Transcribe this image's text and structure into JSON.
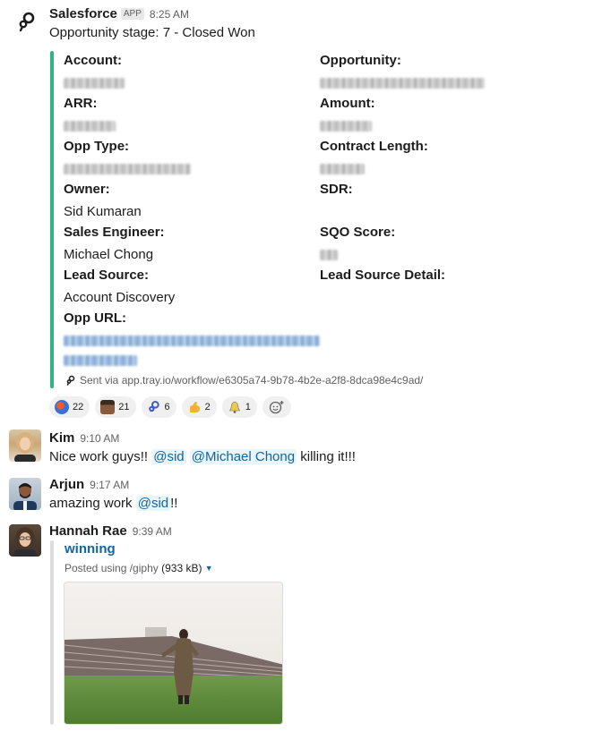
{
  "salesforce": {
    "sender": "Salesforce",
    "app_badge": "APP",
    "time": "8:25 AM",
    "text": "Opportunity stage: 7 - Closed Won",
    "fields": {
      "account": {
        "label": "Account:"
      },
      "opportunity": {
        "label": "Opportunity:"
      },
      "arr": {
        "label": "ARR:"
      },
      "amount": {
        "label": "Amount:"
      },
      "opp_type": {
        "label": "Opp Type:"
      },
      "contract_length": {
        "label": "Contract Length:"
      },
      "owner": {
        "label": "Owner:",
        "value": "Sid Kumaran"
      },
      "sdr": {
        "label": "SDR:"
      },
      "sales_engineer": {
        "label": "Sales Engineer:",
        "value": "Michael Chong"
      },
      "sqo_score": {
        "label": "SQO Score:"
      },
      "lead_source": {
        "label": "Lead Source:",
        "value": "Account Discovery"
      },
      "lead_source_detail": {
        "label": "Lead Source Detail:"
      },
      "opp_url": {
        "label": "Opp URL:"
      }
    },
    "footer": "Sent via app.tray.io/workflow/e6305a74-9b78-4b2e-a2f8-8dca98e4c9ad/",
    "reactions": [
      {
        "emoji": "globe-emoji",
        "count": "22",
        "color": "#3b6fd8"
      },
      {
        "emoji": "face-emoji",
        "count": "21",
        "color": "#6b3b2a"
      },
      {
        "emoji": "tray-logo-emoji",
        "count": "6",
        "color": "#1d1c1d"
      },
      {
        "emoji": "flexed-biceps-emoji",
        "count": "2",
        "color": "#f2b233"
      },
      {
        "emoji": "bell-emoji",
        "count": "1",
        "color": "#e8c95a"
      }
    ]
  },
  "kim": {
    "name": "Kim",
    "time": "9:10 AM",
    "text_before": "Nice work guys!!",
    "mention1": "@sid",
    "mention2": "@Michael Chong",
    "text_after": "killing it!!!"
  },
  "arjun": {
    "name": "Arjun",
    "time": "9:17 AM",
    "text_before": "amazing work",
    "mention": "@sid",
    "text_after": "!!"
  },
  "hannah": {
    "name": "Hannah Rae",
    "time": "9:39 AM",
    "giphy_title": "winning",
    "giphy_meta": "Posted using /giphy",
    "giphy_size": "(933 kB)"
  }
}
